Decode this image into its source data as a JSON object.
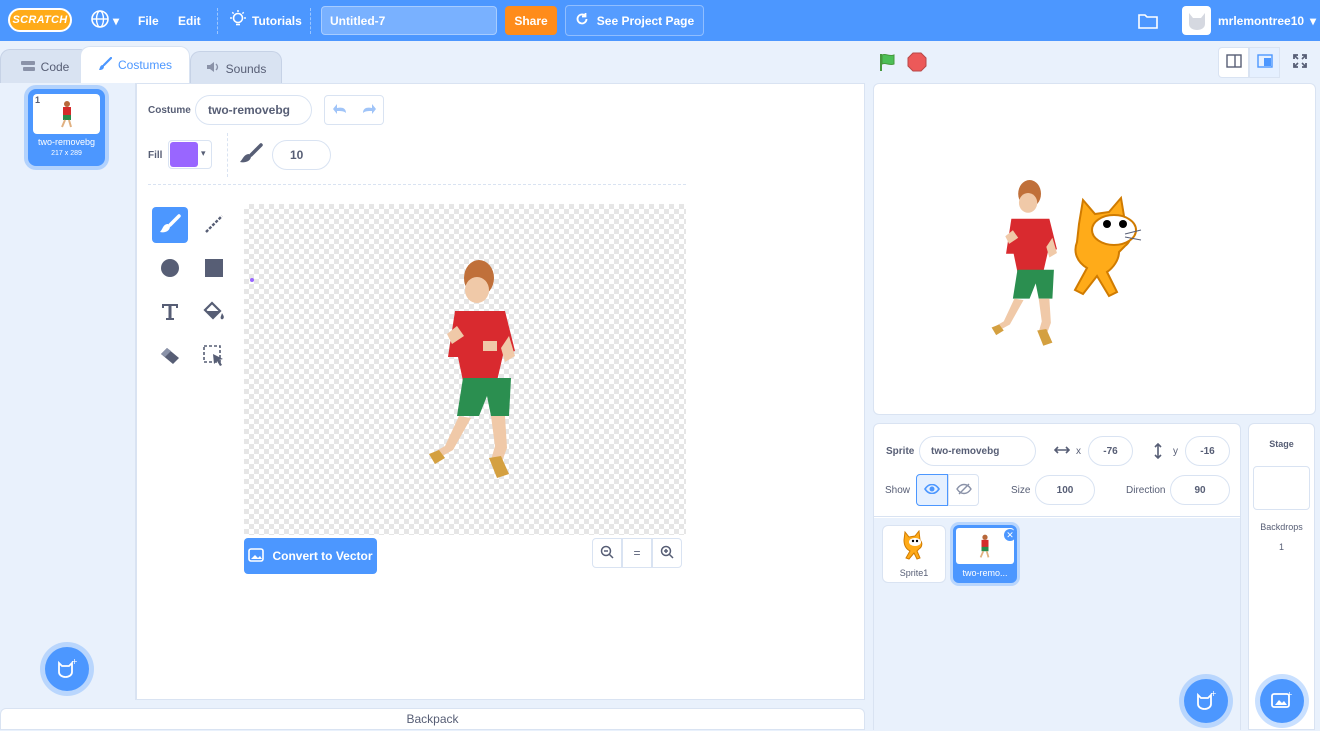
{
  "menubar": {
    "logo": "SCRATCH",
    "file": "File",
    "edit": "Edit",
    "tutorials": "Tutorials",
    "project_title": "Untitled-7",
    "share": "Share",
    "see_project_page": "See Project Page",
    "username": "mrlemontree10"
  },
  "tabs": {
    "code": "Code",
    "costumes": "Costumes",
    "sounds": "Sounds"
  },
  "costume_list": {
    "items": [
      {
        "number": "1",
        "name": "two-removebg",
        "size": "217 x 289"
      }
    ]
  },
  "editor": {
    "costume_label": "Costume",
    "costume_name": "two-removebg",
    "fill_label": "Fill",
    "fill_color": "#9966ff",
    "brush_size": "10",
    "convert_button": "Convert to Vector",
    "zoom_reset": "="
  },
  "sprite_info": {
    "sprite_label": "Sprite",
    "sprite_name": "two-removebg",
    "x_label": "x",
    "x_value": "-76",
    "y_label": "y",
    "y_value": "-16",
    "show_label": "Show",
    "size_label": "Size",
    "size_value": "100",
    "direction_label": "Direction",
    "direction_value": "90"
  },
  "sprites": [
    {
      "name": "Sprite1"
    },
    {
      "name": "two-remo..."
    }
  ],
  "stage_pane": {
    "title": "Stage",
    "backdrops_label": "Backdrops",
    "backdrops_count": "1"
  },
  "backpack": "Backpack",
  "colors": {
    "accent": "#4c97ff",
    "share": "#ff8c1a",
    "flag": "#4cbf56",
    "stop": "#ec5959"
  }
}
